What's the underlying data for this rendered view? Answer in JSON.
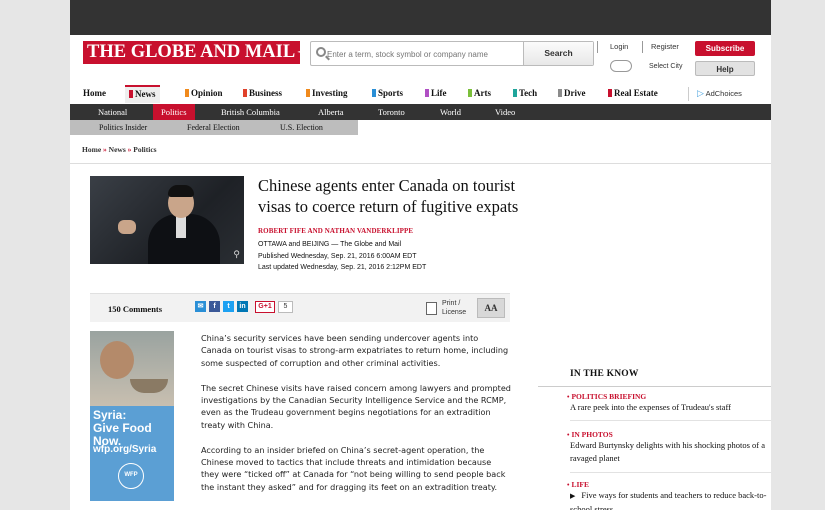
{
  "header": {
    "logo": "THE GLOBE AND MAIL",
    "search_placeholder": "Enter a term, stock symbol or company name",
    "search_button": "Search",
    "login": "Login",
    "register": "Register",
    "select_city": "Select City",
    "subscribe": "Subscribe",
    "help": "Help"
  },
  "main_nav": [
    {
      "label": "Home",
      "color": ""
    },
    {
      "label": "News",
      "color": "#c8102e"
    },
    {
      "label": "Opinion",
      "color": "#f08a1c"
    },
    {
      "label": "Business",
      "color": "#e0412a"
    },
    {
      "label": "Investing",
      "color": "#f08a1c"
    },
    {
      "label": "Sports",
      "color": "#2a8fd6"
    },
    {
      "label": "Life",
      "color": "#b04fc4"
    },
    {
      "label": "Arts",
      "color": "#7bbf3a"
    },
    {
      "label": "Tech",
      "color": "#1fa59b"
    },
    {
      "label": "Drive",
      "color": "#8b8b8b"
    },
    {
      "label": "Real Estate",
      "color": "#c8102e"
    }
  ],
  "adchoices": "AdChoices",
  "sub_nav": [
    "National",
    "Politics",
    "British Columbia",
    "Alberta",
    "Toronto",
    "World",
    "Video"
  ],
  "sub_nav2": [
    "Politics Insider",
    "Federal Election",
    "U.S. Election"
  ],
  "breadcrumb": [
    "Home",
    "News",
    "Politics"
  ],
  "article": {
    "headline": "Chinese agents enter Canada on tourist visas to coerce return of fugitive expats",
    "byline": "ROBERT FIFE AND NATHAN VANDERKLIPPE",
    "dateline": "OTTAWA and BEIJING — The Globe and Mail",
    "published": "Published Wednesday, Sep. 21, 2016 6:00AM EDT",
    "updated": "Last updated Wednesday, Sep. 21, 2016 2:12PM EDT",
    "comments": "150 Comments",
    "gplus": "G+1",
    "share_count": "5",
    "print_label": "Print /",
    "license_label": "License",
    "font_button": "AA",
    "paragraphs": [
      "China’s security services have been sending undercover agents into Canada on tourist visas to strong-arm expatriates to return home, including some suspected of corruption and other criminal activities.",
      "The secret Chinese visits have raised concern among lawyers and prompted investigations by the Canadian Security Intelligence Service and the RCMP, even as the Trudeau government begins negotiations for an extradition treaty with China.",
      "According to an insider briefed on China’s secret-agent operation, the Chinese moved to tactics that include threats and intimidation because they were “ticked off” at Canada for “not being willing to send people back the instant they asked” and for dragging its feet on an extradition treaty."
    ]
  },
  "ad": {
    "line1": "Syria:",
    "line2": "Give Food Now.",
    "url": "wfp.org/Syria",
    "logo": "WFP"
  },
  "in_the_know": {
    "title": "IN THE KNOW",
    "items": [
      {
        "category": "POLITICS BRIEFING",
        "text": "A rare peek into the expenses of Trudeau's staff"
      },
      {
        "category": "IN PHOTOS",
        "text": "Edward Burtynsky delights with his shocking photos of a ravaged planet"
      },
      {
        "category": "LIFE",
        "text": "Five ways for students and teachers to reduce back-to-school stress"
      }
    ]
  }
}
